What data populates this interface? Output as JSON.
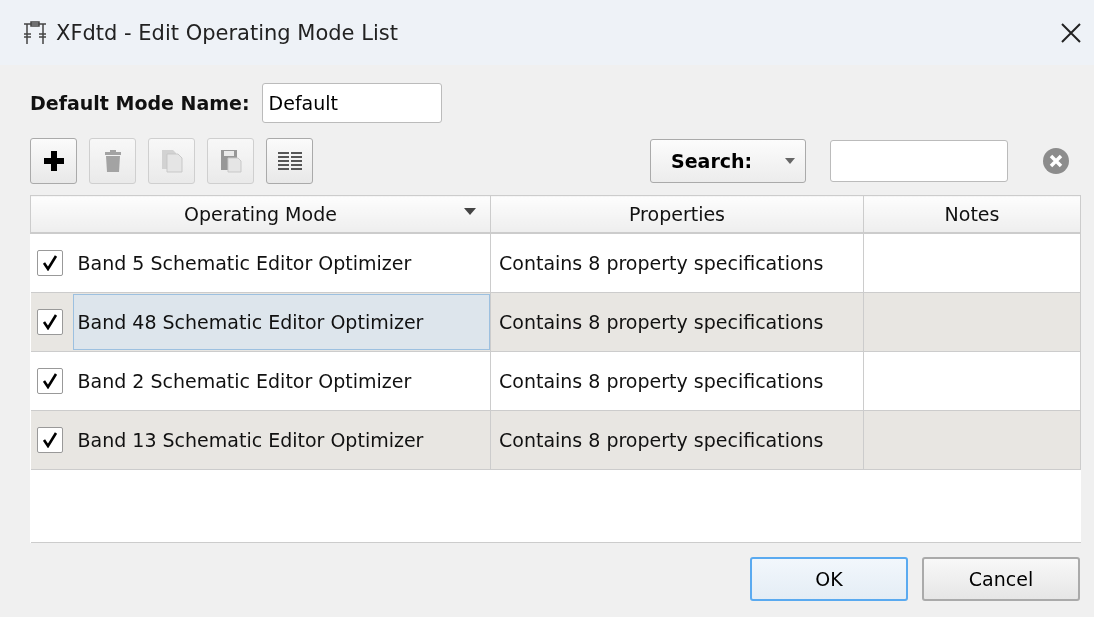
{
  "window": {
    "title": "XFdtd - Edit Operating Mode List"
  },
  "default_mode_name": {
    "label": "Default Mode Name:",
    "value": "Default"
  },
  "toolbar": [
    {
      "kind": "add",
      "disabled": false
    },
    {
      "kind": "delete",
      "disabled": true
    },
    {
      "kind": "copy",
      "disabled": true
    },
    {
      "kind": "paste",
      "disabled": true
    },
    {
      "kind": "list",
      "disabled": false
    }
  ],
  "search": {
    "label": "Search:"
  },
  "table": {
    "columns": [
      {
        "label": "Operating Mode",
        "sorted": true
      },
      {
        "label": "Properties",
        "sorted": false
      },
      {
        "label": "Notes",
        "sorted": false
      }
    ],
    "rows": [
      {
        "checked": true,
        "operating_mode": "Band 5 Schematic Editor Optimizer",
        "properties": "Contains 8 property specifications",
        "selected": false
      },
      {
        "checked": true,
        "operating_mode": "Band 48 Schematic Editor Optimizer",
        "properties": "Contains 8 property specifications",
        "selected": true
      },
      {
        "checked": true,
        "operating_mode": "Band 2 Schematic Editor Optimizer",
        "properties": "Contains 8 property specifications",
        "selected": false
      },
      {
        "checked": true,
        "operating_mode": "Band 13 Schematic Editor Optimizer",
        "properties": "Contains 8 property specifications",
        "selected": false
      }
    ]
  },
  "buttons": [
    {
      "label": "OK",
      "default": true
    },
    {
      "label": "Cancel",
      "default": false
    }
  ]
}
